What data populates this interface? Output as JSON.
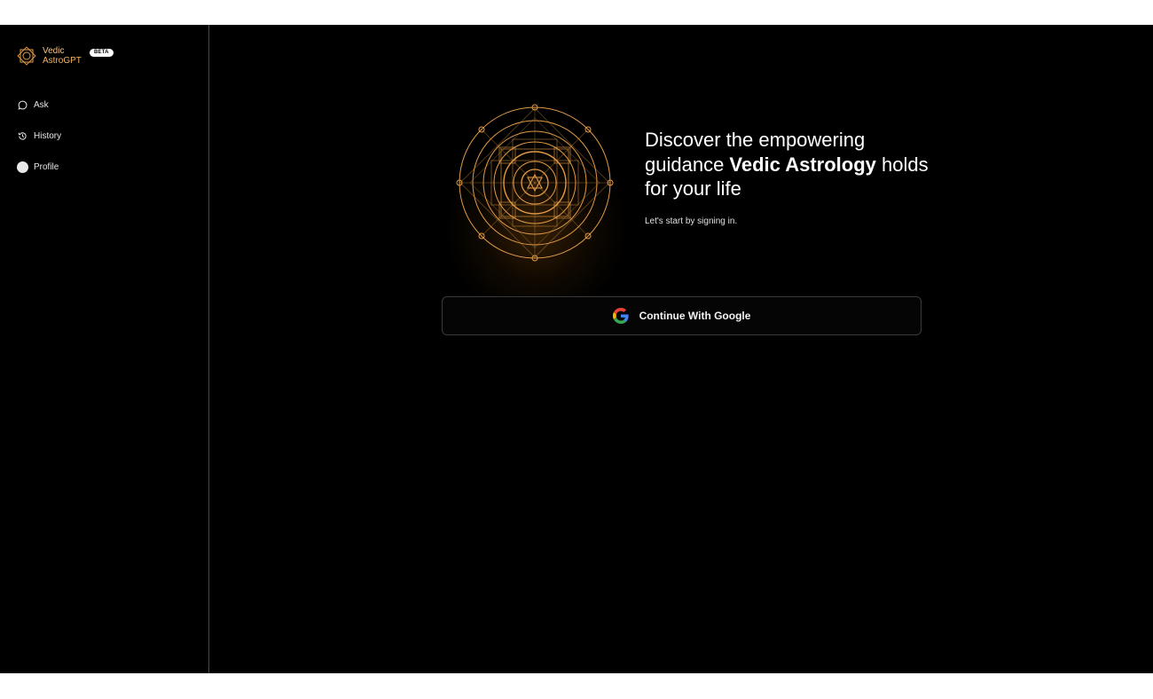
{
  "brand": {
    "line1": "Vedic",
    "line2": "AstroGPT",
    "badge": "BETA",
    "logo_icon": "mandala-star-logo-icon",
    "accent_color": "#f0b366"
  },
  "sidebar": {
    "items": [
      {
        "label": "Ask",
        "icon": "chat-bubble-icon"
      },
      {
        "label": "History",
        "icon": "history-clock-icon"
      },
      {
        "label": "Profile",
        "icon": "avatar-circle-icon"
      }
    ]
  },
  "main": {
    "headline_part1": "Discover the empowering guidance ",
    "headline_bold": "Vedic Astrology",
    "headline_part2": " holds for your life",
    "subtext": "Let's start by signing in.",
    "illustration_icon": "vedic-mandala-illustration",
    "signin_button": {
      "label": "Continue With Google",
      "icon": "google-g-icon"
    }
  },
  "colors": {
    "background": "#000000",
    "mandala": "#e39a45",
    "text": "#ffffff"
  }
}
